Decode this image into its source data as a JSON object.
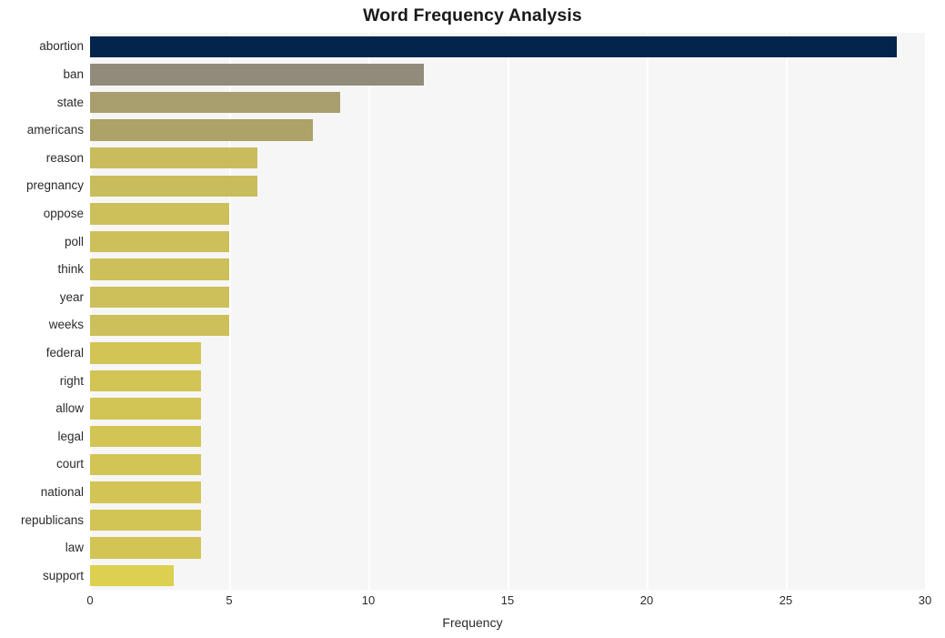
{
  "chart_data": {
    "type": "bar",
    "orientation": "horizontal",
    "title": "Word Frequency Analysis",
    "xlabel": "Frequency",
    "ylabel": "",
    "xlim": [
      0,
      30
    ],
    "ylim": null,
    "grid": true,
    "legend": null,
    "x_ticks": [
      "0",
      "5",
      "10",
      "15",
      "20",
      "25",
      "30"
    ],
    "x_tick_values": [
      0,
      5,
      10,
      15,
      20,
      25,
      30
    ],
    "categories": [
      "abortion",
      "ban",
      "state",
      "americans",
      "reason",
      "pregnancy",
      "oppose",
      "poll",
      "think",
      "year",
      "weeks",
      "federal",
      "right",
      "allow",
      "legal",
      "court",
      "national",
      "republicans",
      "law",
      "support"
    ],
    "values": [
      29,
      12,
      9,
      8,
      6,
      6,
      5,
      5,
      5,
      5,
      5,
      4,
      4,
      4,
      4,
      4,
      4,
      4,
      4,
      3
    ],
    "bar_colors": [
      "#03244d",
      "#918b7b",
      "#a89e6e",
      "#ad a267",
      "#c9bc5c",
      "#c9bc5c",
      "#cdbf59",
      "#cdbf59",
      "#cdbf59",
      "#cdbf59",
      "#cdbf59",
      "#d2c455",
      "#d2c455",
      "#d2c455",
      "#d2c455",
      "#d2c455",
      "#d2c455",
      "#d2c455",
      "#d2c455",
      "#ddcf4f"
    ],
    "plot_background": "#f6f6f6",
    "gridline_color": "#ffffff",
    "figure_background": "#ffffff"
  }
}
